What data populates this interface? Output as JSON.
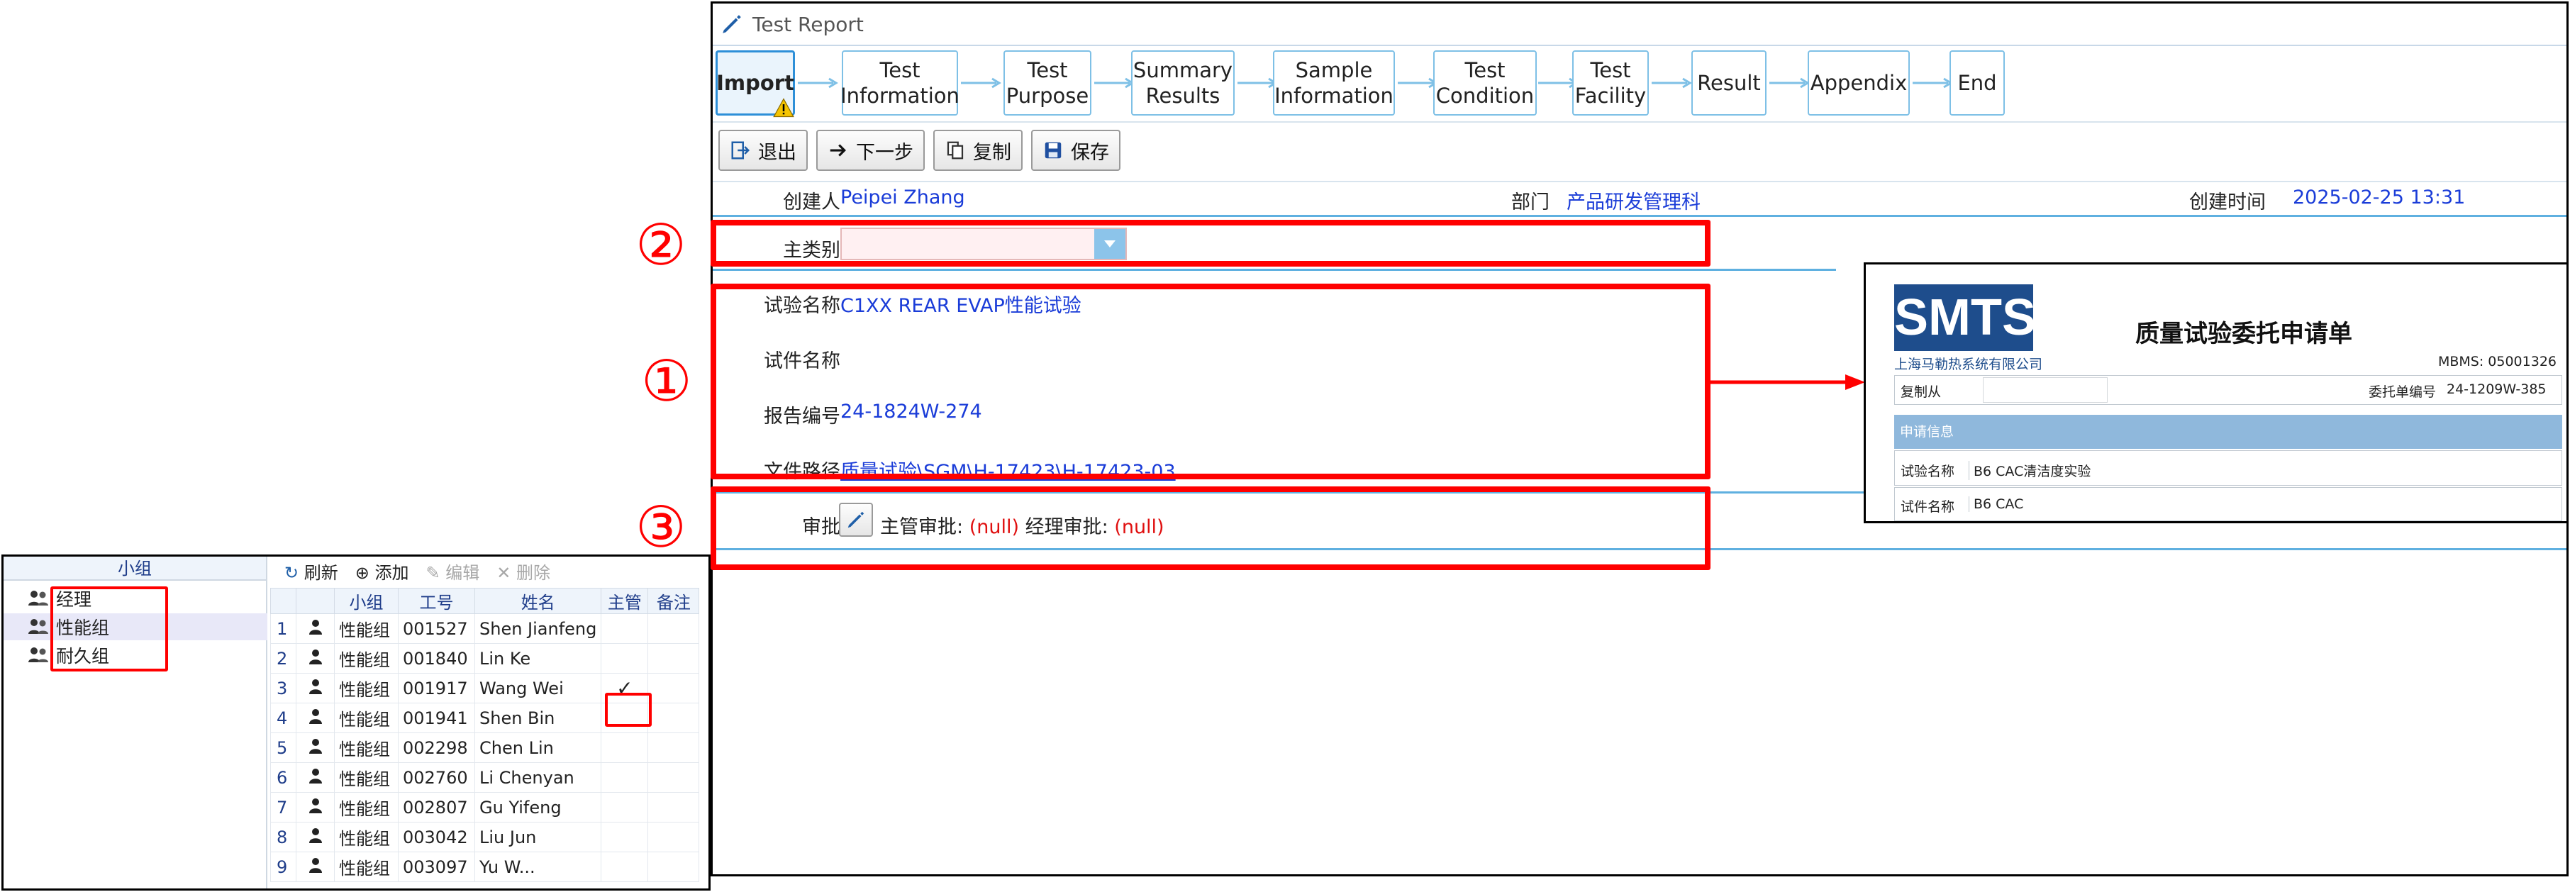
{
  "window": {
    "title": "Test Report"
  },
  "wizard": {
    "steps": [
      {
        "label": "Import",
        "active": true
      },
      {
        "label": "Test\nInformation"
      },
      {
        "label": "Test\nPurpose"
      },
      {
        "label": "Summary\nResults"
      },
      {
        "label": "Sample\nInformation"
      },
      {
        "label": "Test\nCondition"
      },
      {
        "label": "Test\nFacility"
      },
      {
        "label": "Result"
      },
      {
        "label": "Appendix"
      },
      {
        "label": "End"
      }
    ]
  },
  "toolbar": {
    "exit": "退出",
    "next": "下一步",
    "copy": "复制",
    "save": "保存"
  },
  "info": {
    "creator_label": "创建人",
    "creator": "Peipei Zhang",
    "dept_label": "部门",
    "dept": "产品研发管理科",
    "created_label": "创建时间",
    "created": "2025-02-25 13:31"
  },
  "category": {
    "label": "主类别",
    "value": ""
  },
  "test": {
    "name_label": "试验名称",
    "name": "C1XX REAR EVAP性能试验",
    "part_label": "试件名称",
    "part": "",
    "report_label": "报告编号",
    "report": "24-1824W-274",
    "path_label": "文件路径",
    "path": "质量试验\\SGM\\H-17423\\H-17423-03"
  },
  "approval": {
    "label": "审批",
    "supervisor_label": "主管审批:",
    "supervisor": "(null)",
    "manager_label": "经理审批:",
    "manager": "(null)"
  },
  "markers": {
    "one": "①",
    "two": "②",
    "three": "③"
  },
  "group_panel": {
    "tree_header": "小组",
    "tree": [
      "经理",
      "性能组",
      "耐久组"
    ],
    "toolbar": {
      "refresh": "刷新",
      "add": "添加",
      "edit": "编辑",
      "delete": "删除"
    },
    "columns": [
      "小组",
      "工号",
      "姓名",
      "主管",
      "备注"
    ],
    "rows": [
      {
        "n": "1",
        "group": "性能组",
        "id": "001527",
        "name": "Shen Jianfeng",
        "lead": ""
      },
      {
        "n": "2",
        "group": "性能组",
        "id": "001840",
        "name": "Lin Ke",
        "lead": ""
      },
      {
        "n": "3",
        "group": "性能组",
        "id": "001917",
        "name": "Wang Wei",
        "lead": "✓"
      },
      {
        "n": "4",
        "group": "性能组",
        "id": "001941",
        "name": "Shen Bin",
        "lead": ""
      },
      {
        "n": "5",
        "group": "性能组",
        "id": "002298",
        "name": "Chen Lin",
        "lead": ""
      },
      {
        "n": "6",
        "group": "性能组",
        "id": "002760",
        "name": "Li Chenyan",
        "lead": ""
      },
      {
        "n": "7",
        "group": "性能组",
        "id": "002807",
        "name": "Gu Yifeng",
        "lead": ""
      },
      {
        "n": "8",
        "group": "性能组",
        "id": "003042",
        "name": "Liu Jun",
        "lead": ""
      },
      {
        "n": "9",
        "group": "性能组",
        "id": "003097",
        "name": "Yu W...",
        "lead": ""
      }
    ]
  },
  "form": {
    "logo": "SMTS",
    "company": "上海马勒热系统有限公司",
    "title": "质量试验委托申请单",
    "code": "MBMS: 05001326",
    "copy_from_label": "复制从",
    "order_label": "委托单编号",
    "order": "24-1209W-385",
    "section": "申请信息",
    "test_name_label": "试验名称",
    "test_name": "B6 CAC清洁度实验",
    "part_label": "试件名称",
    "part": "B6 CAC"
  },
  "colors": {
    "accent": "#2d8fd8",
    "link": "#1a3cd8",
    "highlight": "#ff0000",
    "null": "#e01010"
  }
}
